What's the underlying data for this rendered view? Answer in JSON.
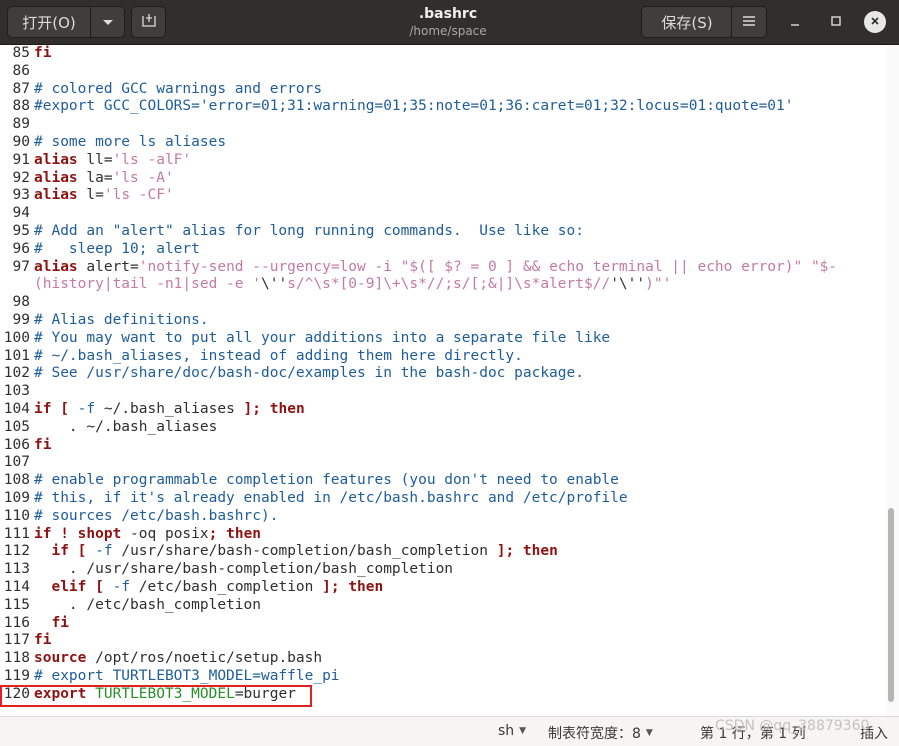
{
  "header": {
    "open_label": "打开(O)",
    "open_menu_icon": "chevron-down-icon",
    "newtab_icon": "new-document-icon",
    "title": ".bashrc",
    "subtitle": "/home/space",
    "save_label": "保存(S)",
    "menu_icon": "hamburger-menu-icon",
    "minimize_icon": "minimize-icon",
    "maximize_icon": "maximize-icon",
    "close_icon": "close-icon"
  },
  "editor": {
    "lines": [
      {
        "n": "85",
        "segs": [
          [
            "kw",
            "fi"
          ]
        ]
      },
      {
        "n": "86",
        "segs": []
      },
      {
        "n": "87",
        "segs": [
          [
            "cm",
            "# colored GCC warnings and errors"
          ]
        ]
      },
      {
        "n": "88",
        "segs": [
          [
            "cm",
            "#export GCC_COLORS='error=01;31:warning=01;35:note=01;36:caret=01;32:locus=01:quote=01'"
          ]
        ]
      },
      {
        "n": "89",
        "segs": []
      },
      {
        "n": "90",
        "segs": [
          [
            "cm",
            "# some more ls aliases"
          ]
        ]
      },
      {
        "n": "91",
        "segs": [
          [
            "kw",
            "alias"
          ],
          [
            "op",
            " ll="
          ],
          [
            "st",
            "'ls -alF'"
          ]
        ]
      },
      {
        "n": "92",
        "segs": [
          [
            "kw",
            "alias"
          ],
          [
            "op",
            " la="
          ],
          [
            "st",
            "'ls -A'"
          ]
        ]
      },
      {
        "n": "93",
        "segs": [
          [
            "kw",
            "alias"
          ],
          [
            "op",
            " l="
          ],
          [
            "st",
            "'ls -CF'"
          ]
        ]
      },
      {
        "n": "94",
        "segs": []
      },
      {
        "n": "95",
        "segs": [
          [
            "cm",
            "# Add an \"alert\" alias for long running commands.  Use like so:"
          ]
        ]
      },
      {
        "n": "96",
        "segs": [
          [
            "cm",
            "#   sleep 10; alert"
          ]
        ]
      },
      {
        "n": "97",
        "segs": [
          [
            "kw",
            "alias"
          ],
          [
            "op",
            " alert="
          ],
          [
            "st",
            "'notify-send --urgency=low -i \"$([ $? = 0 ] && echo terminal || echo error)\" \"$-"
          ]
        ]
      },
      {
        "n": "",
        "segs": [
          [
            "st",
            "(history|tail -n1|sed -e '"
          ],
          [
            "op",
            "\\''"
          ],
          [
            "st",
            "s/^\\s*[0-9]\\+\\s*//;s/[;&|]\\s*alert$//"
          ],
          [
            "op",
            "'\\''"
          ],
          [
            "st",
            ")\"'"
          ]
        ]
      },
      {
        "n": "98",
        "segs": []
      },
      {
        "n": "99",
        "segs": [
          [
            "cm",
            "# Alias definitions."
          ]
        ]
      },
      {
        "n": "100",
        "segs": [
          [
            "cm",
            "# You may want to put all your additions into a separate file like"
          ]
        ]
      },
      {
        "n": "101",
        "segs": [
          [
            "cm",
            "# ~/.bash_aliases, instead of adding them here directly."
          ]
        ]
      },
      {
        "n": "102",
        "segs": [
          [
            "cm",
            "# See /usr/share/doc/bash-doc/examples in the bash-doc package."
          ]
        ]
      },
      {
        "n": "103",
        "segs": []
      },
      {
        "n": "104",
        "segs": [
          [
            "kw",
            "if"
          ],
          [
            "op",
            " "
          ],
          [
            "kw",
            "["
          ],
          [
            "op",
            " "
          ],
          [
            "cm",
            "-f"
          ],
          [
            "op",
            " ~/.bash_aliases "
          ],
          [
            "kw",
            "];"
          ],
          [
            "op",
            " "
          ],
          [
            "kw",
            "then"
          ]
        ]
      },
      {
        "n": "105",
        "segs": [
          [
            "op",
            "    . ~/.bash_aliases"
          ]
        ]
      },
      {
        "n": "106",
        "segs": [
          [
            "kw",
            "fi"
          ]
        ]
      },
      {
        "n": "107",
        "segs": []
      },
      {
        "n": "108",
        "segs": [
          [
            "cm",
            "# enable programmable completion features (you don't need to enable"
          ]
        ]
      },
      {
        "n": "109",
        "segs": [
          [
            "cm",
            "# this, if it's already enabled in /etc/bash.bashrc and /etc/profile"
          ]
        ]
      },
      {
        "n": "110",
        "segs": [
          [
            "cm",
            "# sources /etc/bash.bashrc)."
          ]
        ]
      },
      {
        "n": "111",
        "segs": [
          [
            "kw",
            "if"
          ],
          [
            "op",
            " "
          ],
          [
            "kw",
            "!"
          ],
          [
            "op",
            " "
          ],
          [
            "kw",
            "shopt"
          ],
          [
            "op",
            " -oq posix"
          ],
          [
            "kw",
            ";"
          ],
          [
            "op",
            " "
          ],
          [
            "kw",
            "then"
          ]
        ]
      },
      {
        "n": "112",
        "segs": [
          [
            "op",
            "  "
          ],
          [
            "kw",
            "if"
          ],
          [
            "op",
            " "
          ],
          [
            "kw",
            "["
          ],
          [
            "op",
            " "
          ],
          [
            "cm",
            "-f"
          ],
          [
            "op",
            " /usr/share/bash-completion/bash_completion "
          ],
          [
            "kw",
            "];"
          ],
          [
            "op",
            " "
          ],
          [
            "kw",
            "then"
          ]
        ]
      },
      {
        "n": "113",
        "segs": [
          [
            "op",
            "    . /usr/share/bash-completion/bash_completion"
          ]
        ]
      },
      {
        "n": "114",
        "segs": [
          [
            "op",
            "  "
          ],
          [
            "kw",
            "elif"
          ],
          [
            "op",
            " "
          ],
          [
            "kw",
            "["
          ],
          [
            "op",
            " "
          ],
          [
            "cm",
            "-f"
          ],
          [
            "op",
            " /etc/bash_completion "
          ],
          [
            "kw",
            "];"
          ],
          [
            "op",
            " "
          ],
          [
            "kw",
            "then"
          ]
        ]
      },
      {
        "n": "115",
        "segs": [
          [
            "op",
            "    . /etc/bash_completion"
          ]
        ]
      },
      {
        "n": "116",
        "segs": [
          [
            "op",
            "  "
          ],
          [
            "kw",
            "fi"
          ]
        ]
      },
      {
        "n": "117",
        "segs": [
          [
            "kw",
            "fi"
          ]
        ]
      },
      {
        "n": "118",
        "segs": [
          [
            "kw",
            "source"
          ],
          [
            "op",
            " /opt/ros/noetic/setup.bash"
          ]
        ]
      },
      {
        "n": "119",
        "segs": [
          [
            "cm",
            "# export TURTLEBOT3_MODEL=waffle_pi"
          ]
        ]
      },
      {
        "n": "120",
        "segs": [
          [
            "kw",
            "export"
          ],
          [
            "op",
            " "
          ],
          [
            "vr",
            "TURTLEBOT3_MODEL"
          ],
          [
            "op",
            "=burger"
          ]
        ]
      }
    ]
  },
  "statusbar": {
    "language": "sh",
    "tab_width": "制表符宽度：8",
    "position": "第 1 行，第 1 列",
    "insert_mode": "插入",
    "watermark": "CSDN @qq_38879360"
  },
  "colors": {
    "header_bg": "#302f2c",
    "comment": "#1f5d99",
    "keyword": "#8f1212",
    "string": "#c47aa5",
    "variable": "#2a8f2a",
    "highlight_box": "#e1231c"
  }
}
